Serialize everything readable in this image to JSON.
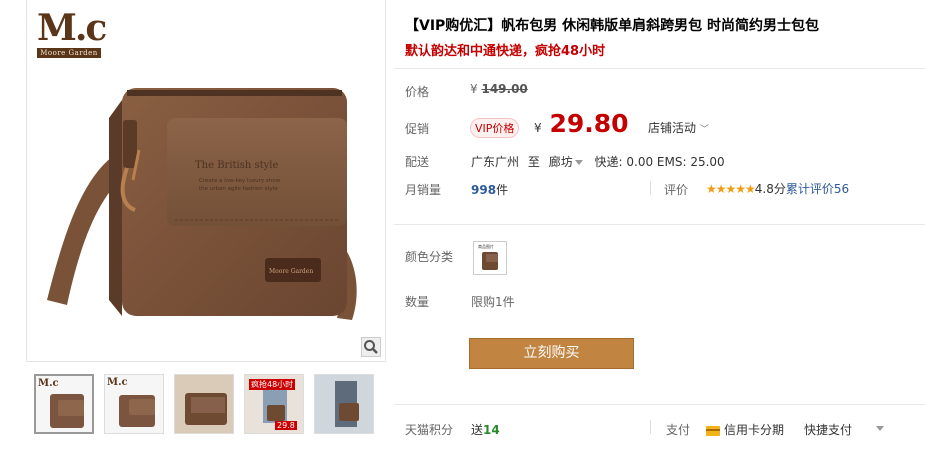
{
  "brand": {
    "logo_text": "M.c",
    "logo_sub": "Moore Garden"
  },
  "product": {
    "title": "【VIP购优汇】帆布包男 休闲韩版单肩斜跨男包 时尚简约男士包包",
    "subtitle": "默认韵达和中通快递，疯抢48小时",
    "bag_print": {
      "title": "The British style",
      "line1": "Create a low-key luxury show",
      "line2": "the urban agile fashion style",
      "patch": "Moore Garden"
    }
  },
  "price": {
    "label": "价格",
    "currency": "¥",
    "original": "149.00"
  },
  "promo": {
    "label": "促销",
    "tag": "VIP价格",
    "currency": "¥",
    "price": "29.80",
    "activity": "店铺活动"
  },
  "shipping": {
    "label": "配送",
    "from": "广东广州",
    "to_word": "至",
    "dest": "廊坊",
    "fees": "快递: 0.00 EMS: 25.00"
  },
  "sales": {
    "label": "月销量",
    "count": "998",
    "unit": "件"
  },
  "rating": {
    "label": "评价",
    "stars": "★★★★★",
    "score": "4.8分",
    "text": "累计评价",
    "count": "56"
  },
  "color": {
    "label": "颜色分类",
    "swatch_caption": "商品图片"
  },
  "quantity": {
    "label": "数量",
    "limit": "限购1件"
  },
  "buy_button": "立刻购买",
  "points": {
    "label": "天猫积分",
    "prefix": "送",
    "value": "14"
  },
  "payment": {
    "label": "支付",
    "credit": "信用卡分期",
    "quick": "快捷支付"
  },
  "thumb_labels": {
    "t1": "M.c",
    "t2": "M.c",
    "t4_tag": "疯抢48小时",
    "t4_price": "29.8"
  }
}
